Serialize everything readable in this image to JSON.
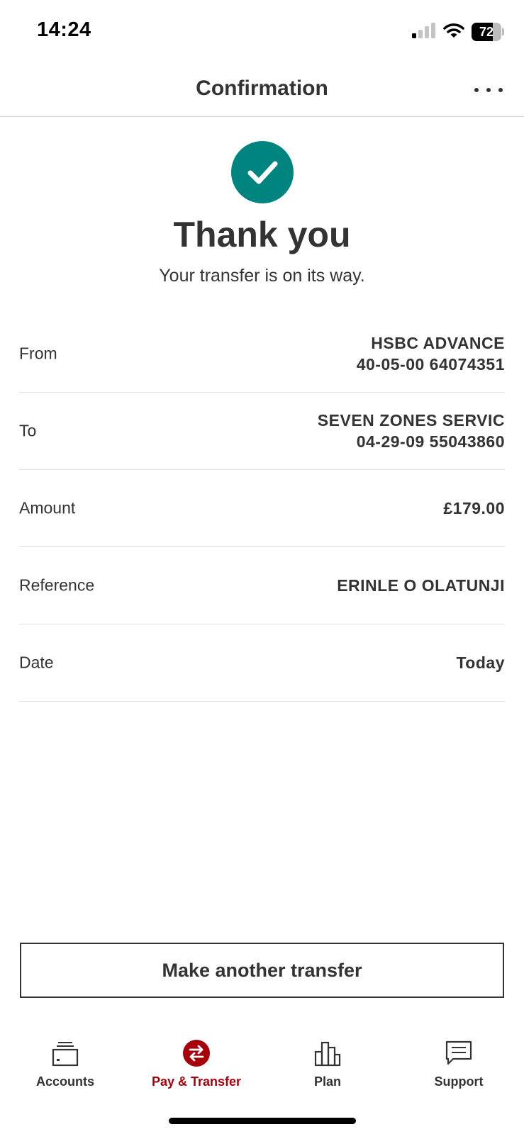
{
  "status_bar": {
    "time": "14:24",
    "battery": "72",
    "battery_level": 0.72,
    "icons": [
      "cellular-signal-icon",
      "wifi-icon",
      "battery-icon"
    ]
  },
  "header": {
    "title": "Confirmation",
    "more_icon": "more-options-icon"
  },
  "confirmation": {
    "icon": "check-circle-icon",
    "icon_color": "#00847f",
    "title": "Thank you",
    "subtitle": "Your transfer is on its way."
  },
  "details": [
    {
      "label": "From",
      "value_lines": [
        "HSBC ADVANCE",
        "40-05-00 64074351"
      ]
    },
    {
      "label": "To",
      "value_lines": [
        "SEVEN ZONES SERVIC",
        "04-29-09 55043860"
      ]
    },
    {
      "label": "Amount",
      "value_lines": [
        "£179.00"
      ]
    },
    {
      "label": "Reference",
      "value_lines": [
        "ERINLE O OLATUNJI"
      ]
    },
    {
      "label": "Date",
      "value_lines": [
        "Today"
      ]
    }
  ],
  "actions": {
    "make_another_transfer": "Make another transfer"
  },
  "tab_bar": {
    "active_color": "#a8000b",
    "items": [
      {
        "label": "Accounts",
        "icon": "wallet-icon",
        "active": false
      },
      {
        "label": "Pay & Transfer",
        "icon": "transfer-arrows-icon",
        "active": true
      },
      {
        "label": "Plan",
        "icon": "bar-chart-icon",
        "active": false
      },
      {
        "label": "Support",
        "icon": "chat-icon",
        "active": false
      }
    ]
  }
}
